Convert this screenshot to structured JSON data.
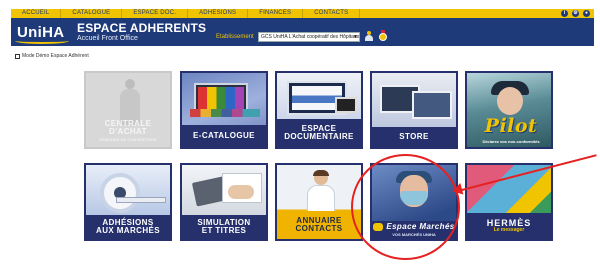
{
  "topnav": {
    "items": [
      "ACCUEIL",
      "CATALOGUE",
      "ESPACE DOC.",
      "ADHESIONS",
      "FINANCES",
      "CONTACTS"
    ],
    "icons": [
      "info-icon",
      "settings-icon",
      "user-icon"
    ]
  },
  "header": {
    "logo": "UniHA",
    "title": "ESPACE ADHERENTS",
    "subtitle": "Accueil Front Office",
    "etablissement_label": "Etablissement",
    "etablissement_value": "GCS UniHA L'Achat coopératif des Hôpitaux"
  },
  "demo_mode": {
    "label": "Mode Démo Espace Adhérent",
    "checked": false
  },
  "tiles": {
    "centrale": {
      "line1": "CENTRALE D'ACHAT",
      "line2": "DEMANDE DE CONVENTIONS",
      "enabled": false
    },
    "ecatalogue": {
      "line1": "E-CATALOGUE"
    },
    "documentaire": {
      "line1": "ESPACE",
      "line2": "DOCUMENTAIRE"
    },
    "store": {
      "line1": "STORE"
    },
    "pilot": {
      "word": "Pilot",
      "sub": "Déclarez vos non-conformités"
    },
    "adhesions": {
      "line1": "ADHÉSIONS",
      "line2": "AUX MARCHÉS"
    },
    "simulation": {
      "line1": "SIMULATION",
      "line2": "ET TITRES"
    },
    "annuaire": {
      "line1": "ANNUAIRE",
      "line2": "CONTACTS"
    },
    "marches": {
      "line1": "Espace Marchés",
      "line2": "VOS MARCHÉS UNIHA"
    },
    "hermes": {
      "line1": "HERMÈS",
      "line2": "Le messager"
    }
  },
  "colors": {
    "navy": "#1f3a78",
    "yellow": "#f0c400",
    "tile_band": "#25306d",
    "annotation": "#e52222"
  }
}
